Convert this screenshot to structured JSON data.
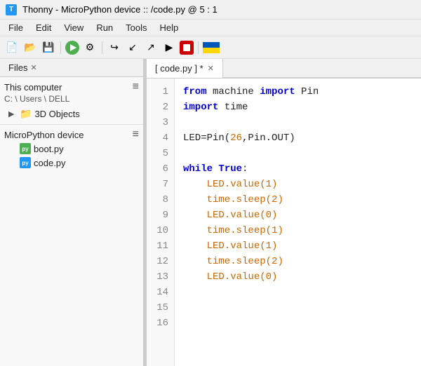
{
  "titleBar": {
    "appName": "Thonny",
    "separator": " - ",
    "deviceName": "MicroPython device",
    "pathSep": " :: ",
    "filePath": "/code.py",
    "position": "@ 5 : 1"
  },
  "menuBar": {
    "items": [
      "File",
      "Edit",
      "View",
      "Run",
      "Tools",
      "Help"
    ]
  },
  "filesPanel": {
    "tabLabel": "Files",
    "thisComputer": {
      "label": "This computer",
      "path": "C: \\ Users \\ DELL"
    },
    "treeItems": [
      {
        "label": "3D Objects",
        "type": "folder"
      }
    ],
    "microPythonDevice": {
      "label": "MicroPython device",
      "files": [
        {
          "label": "boot.py",
          "type": "py-green"
        },
        {
          "label": "code.py",
          "type": "py-blue"
        }
      ]
    }
  },
  "codeTab": {
    "label": "[ code.py ] *"
  },
  "lineNumbers": [
    1,
    2,
    3,
    4,
    5,
    6,
    7,
    8,
    9,
    10,
    11,
    12,
    13,
    14,
    15,
    16
  ],
  "codeLines": [
    {
      "id": 1,
      "tokens": [
        {
          "t": "from",
          "c": "kw-from"
        },
        {
          "t": " machine ",
          "c": "normal"
        },
        {
          "t": "import",
          "c": "kw-import"
        },
        {
          "t": " Pin",
          "c": "normal"
        }
      ]
    },
    {
      "id": 2,
      "tokens": [
        {
          "t": "import",
          "c": "kw-import"
        },
        {
          "t": " time",
          "c": "normal"
        }
      ]
    },
    {
      "id": 3,
      "tokens": []
    },
    {
      "id": 4,
      "tokens": [
        {
          "t": "LED=Pin(",
          "c": "normal"
        },
        {
          "t": "26",
          "c": "num"
        },
        {
          "t": ",Pin.OUT)",
          "c": "normal"
        }
      ]
    },
    {
      "id": 5,
      "tokens": []
    },
    {
      "id": 6,
      "tokens": [
        {
          "t": "while",
          "c": "kw-while"
        },
        {
          "t": " ",
          "c": "normal"
        },
        {
          "t": "True",
          "c": "kw-true"
        },
        {
          "t": ":",
          "c": "normal"
        }
      ]
    },
    {
      "id": 7,
      "tokens": [
        {
          "t": "    LED.value(",
          "c": "num"
        },
        {
          "t": "1",
          "c": "num"
        },
        {
          "t": ")",
          "c": "num"
        }
      ]
    },
    {
      "id": 8,
      "tokens": [
        {
          "t": "    time.sleep(",
          "c": "num"
        },
        {
          "t": "2",
          "c": "num"
        },
        {
          "t": ")",
          "c": "num"
        }
      ]
    },
    {
      "id": 9,
      "tokens": [
        {
          "t": "    LED.value(",
          "c": "num"
        },
        {
          "t": "0",
          "c": "num"
        },
        {
          "t": ")",
          "c": "num"
        }
      ]
    },
    {
      "id": 10,
      "tokens": [
        {
          "t": "    time.sleep(",
          "c": "num"
        },
        {
          "t": "1",
          "c": "num"
        },
        {
          "t": ")",
          "c": "num"
        }
      ]
    },
    {
      "id": 11,
      "tokens": [
        {
          "t": "    LED.value(",
          "c": "num"
        },
        {
          "t": "1",
          "c": "num"
        },
        {
          "t": ")",
          "c": "num"
        }
      ]
    },
    {
      "id": 12,
      "tokens": [
        {
          "t": "    time.sleep(",
          "c": "num"
        },
        {
          "t": "2",
          "c": "num"
        },
        {
          "t": ")",
          "c": "num"
        }
      ]
    },
    {
      "id": 13,
      "tokens": [
        {
          "t": "    LED.value(",
          "c": "num"
        },
        {
          "t": "0",
          "c": "num"
        },
        {
          "t": ")",
          "c": "num"
        }
      ]
    },
    {
      "id": 14,
      "tokens": []
    },
    {
      "id": 15,
      "tokens": []
    },
    {
      "id": 16,
      "tokens": []
    }
  ]
}
